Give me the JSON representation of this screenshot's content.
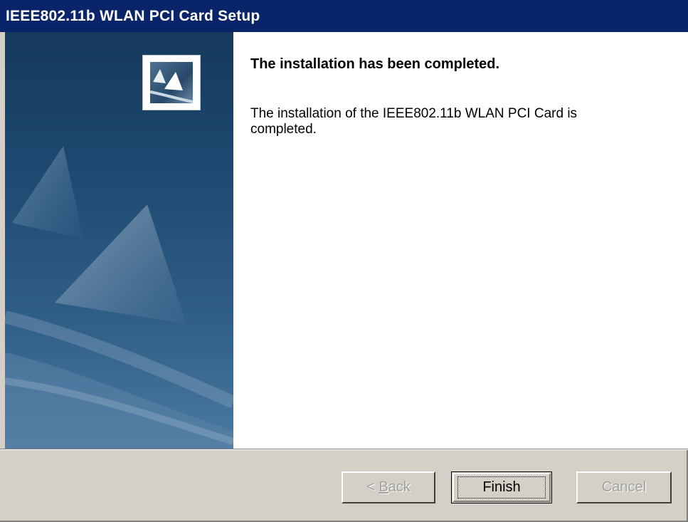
{
  "window": {
    "title": "IEEE802.11b WLAN PCI Card Setup"
  },
  "sidebar": {
    "logo_icon": "setup-logo-icon"
  },
  "content": {
    "heading": "The installation has been completed.",
    "body": "The installation of the IEEE802.11b WLAN PCI Card is completed."
  },
  "buttons": {
    "back_prefix": "< ",
    "back_mnemonic": "B",
    "back_rest": "ack",
    "finish": "Finish",
    "cancel": "Cancel"
  },
  "colors": {
    "titlebar": "#0a246a",
    "face": "#d4d0c8"
  }
}
